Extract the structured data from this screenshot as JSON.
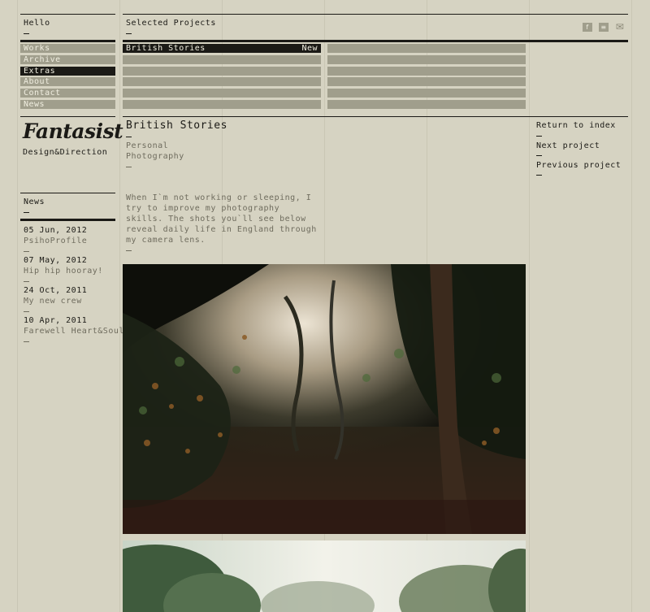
{
  "header": {
    "hello": "Hello",
    "selected_projects": "Selected Projects"
  },
  "social": {
    "facebook": "f",
    "rss": "≡",
    "mail": "✉"
  },
  "nav": {
    "items": [
      {
        "label": "Works",
        "active": false
      },
      {
        "label": "Archive",
        "active": false
      },
      {
        "label": "Extras",
        "active": true
      },
      {
        "label": "About",
        "active": false
      },
      {
        "label": "Contact",
        "active": false
      },
      {
        "label": "News",
        "active": false
      }
    ]
  },
  "projects": {
    "active_title": "British Stories",
    "active_badge": "New"
  },
  "brand": {
    "logo": "Fantasist",
    "tagline": "Design&Direction"
  },
  "news": {
    "title": "News",
    "items": [
      {
        "date": "05 Jun, 2012",
        "title": "PsihoProfile"
      },
      {
        "date": "07 May, 2012",
        "title": "Hip hip hooray!"
      },
      {
        "date": "24 Oct, 2011",
        "title": "My new crew"
      },
      {
        "date": "10 Apr, 2011",
        "title": "Farewell Heart&Soul"
      }
    ]
  },
  "project": {
    "title": "British Stories",
    "category_1": "Personal",
    "category_2": "Photography",
    "description_lines": [
      "When I`m not working or sleeping, I",
      "try to improve my photography",
      "skills. The shots you`ll see below",
      "reveal daily life in England through",
      "my camera lens."
    ]
  },
  "project_nav": {
    "return": "Return to index",
    "next": "Next project",
    "previous": "Previous project"
  }
}
